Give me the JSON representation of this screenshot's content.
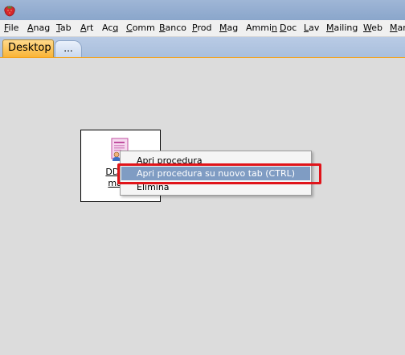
{
  "app": {
    "icon": "strawberry-icon",
    "title_color": "#8aa6cb"
  },
  "menubar": {
    "items": [
      {
        "label": "File",
        "mnemonic": "F"
      },
      {
        "label": "Anag",
        "mnemonic": "A"
      },
      {
        "label": "Tab",
        "mnemonic": "T"
      },
      {
        "label": "Art",
        "mnemonic": "A"
      },
      {
        "label": "Acq",
        "mnemonic": "q"
      },
      {
        "label": "Comm",
        "mnemonic": "C"
      },
      {
        "label": "Banco",
        "mnemonic": "B"
      },
      {
        "label": "Prod",
        "mnemonic": "P"
      },
      {
        "label": "Mag",
        "mnemonic": "M"
      },
      {
        "label": "Ammin",
        "mnemonic": "n"
      },
      {
        "label": "Doc",
        "mnemonic": "D"
      },
      {
        "label": "Lav",
        "mnemonic": "L"
      },
      {
        "label": "Mailing",
        "mnemonic": "M"
      },
      {
        "label": "Web",
        "mnemonic": "W"
      },
      {
        "label": "Mar",
        "mnemonic": "M"
      }
    ]
  },
  "tabs": {
    "active_label": "Desktop",
    "more_label": "...",
    "active_color": "#f9b437"
  },
  "desktop": {
    "shortcut": {
      "icon": "document-user-icon",
      "label_line1": "DDT di",
      "label_line2": "maga"
    }
  },
  "context_menu": {
    "items": [
      {
        "label": "Apri procedura",
        "selected": false
      },
      {
        "label": "Apri procedura su nuovo tab (CTRL)",
        "selected": true
      },
      {
        "label": "Elimina",
        "selected": false
      }
    ],
    "selection_color": "#7f9cc3",
    "highlight_color": "#e0141a"
  }
}
